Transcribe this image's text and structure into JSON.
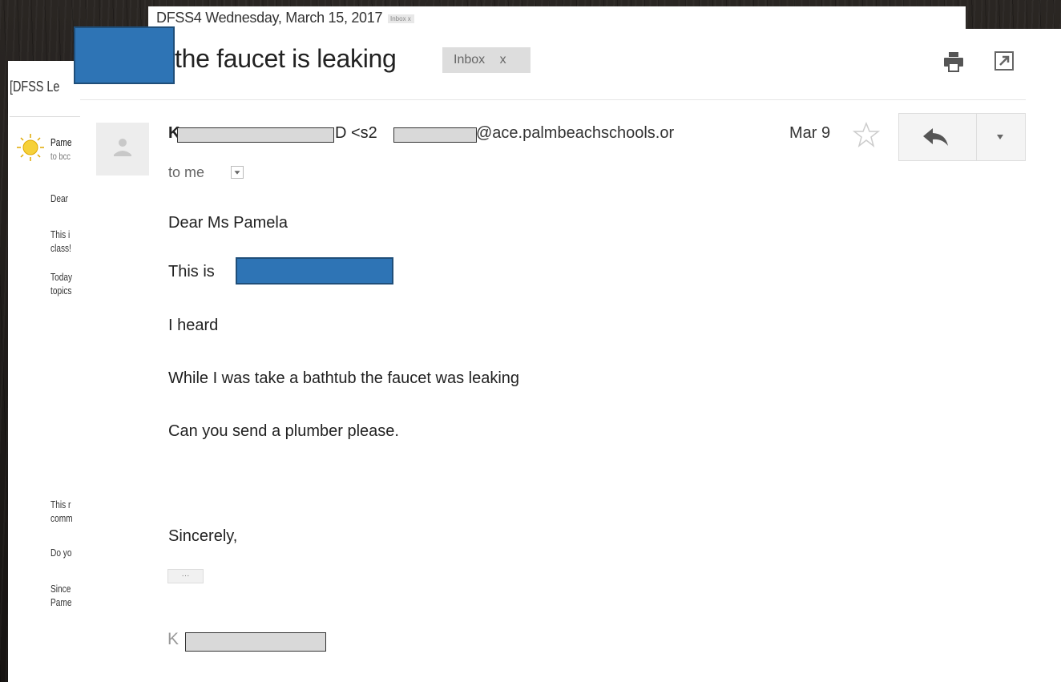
{
  "back_window": {
    "title": "DFSS4 Wednesday, March 15, 2017",
    "inbox_badge": "Inbox x"
  },
  "left_window": {
    "title": "[DFSS Le",
    "sender": "Pame",
    "recipient": "to bcc",
    "lines": [
      {
        "text": "Dear"
      },
      {
        "text": "This i"
      },
      {
        "text": "class!"
      },
      {
        "text": "Today"
      },
      {
        "text": "topics"
      },
      {
        "text": "This r"
      },
      {
        "text": "comm"
      },
      {
        "text": "Do yo"
      },
      {
        "text": "Since"
      },
      {
        "text": "Pame"
      }
    ]
  },
  "email": {
    "subject": "the faucet is leaking",
    "inbox_label": "Inbox",
    "inbox_close": "x",
    "sender_first": "K",
    "sender_mid": "D <s2",
    "sender_domain": "@ace.palmbeachschools.or",
    "date": "Mar 9",
    "to": "to me",
    "body": [
      {
        "text": "Dear Ms Pamela"
      },
      {
        "text": "This is"
      },
      {
        "text": "I heard"
      },
      {
        "text": " While I was take a bathtub the faucet was leaking"
      },
      {
        "text": "Can you send a plumber please."
      },
      {
        "text": "Sincerely,"
      }
    ],
    "ellipsis": "···",
    "signature_initial": "K"
  },
  "icons": {
    "print": "print-icon",
    "popout": "popout-icon",
    "star": "star-icon",
    "reply": "reply-icon",
    "dropdown": "chevron-down-icon",
    "avatar": "person-icon",
    "sun": "sun-avatar-icon"
  },
  "colors": {
    "redaction_blue": "#2e74b5",
    "redaction_gray": "#d9d9d9",
    "background": "#1e1b19"
  }
}
